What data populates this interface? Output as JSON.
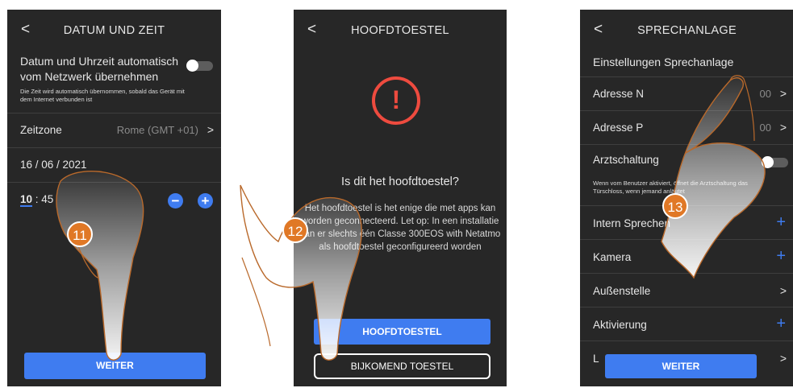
{
  "screen1": {
    "back": "<",
    "title": "DATUM UND ZEIT",
    "auto_label": "Datum und Uhrzeit automatisch vom Netzwerk übernehmen",
    "auto_note": "Die Zeit wird automatisch übernommen, sobald das Gerät mit dem Internet verbunden ist",
    "auto_toggle": "off",
    "timezone_label": "Zeitzone",
    "timezone_value": "Rome (GMT +01)",
    "chevron": ">",
    "date": "16 / 06 / 2021",
    "time_hours": "10",
    "time_sep": " : ",
    "time_minutes": "45",
    "minus": "−",
    "plus": "+",
    "button": "WEITER",
    "step": "11"
  },
  "screen2": {
    "back": "<",
    "title": "HOOFDTOESTEL",
    "alert_mark": "!",
    "question": "Is dit het hoofdtoestel?",
    "description": "Het hoofdtoestel is het enige die met apps kan worden geconnecteerd. Let op: In een installatie kan er slechts één Classe 300EOS with Netatmo als hoofdtoestel geconfigureerd worden",
    "primary_button": "HOOFDTOESTEL",
    "secondary_button": "BIJKOMEND TOESTEL",
    "step": "12"
  },
  "screen3": {
    "back": "<",
    "title": "SPRECHANLAGE",
    "section": "Einstellungen Sprechanlage",
    "chevron": ">",
    "plus": "+",
    "address_n_label": "Adresse N",
    "address_n_value": "00",
    "address_p_label": "Adresse P",
    "address_p_value": "00",
    "doctor_label": "Arztschaltung",
    "doctor_toggle": "off",
    "doctor_note": "Wenn vom Benutzer aktiviert, öffnet die Arztschaltung das Türschloss, wenn jemand anläutet",
    "intercom_label": "Intern Sprechen",
    "camera_label": "Kamera",
    "outdoor_label": "Außenstelle",
    "activation_label": "Aktivierung",
    "partial_label": "L",
    "button": "WEITER",
    "step": "13"
  },
  "colors": {
    "screen_bg": "#272727",
    "accent": "#3f7cf0",
    "alert": "#ee4b3f",
    "step_badge": "#e07826"
  }
}
